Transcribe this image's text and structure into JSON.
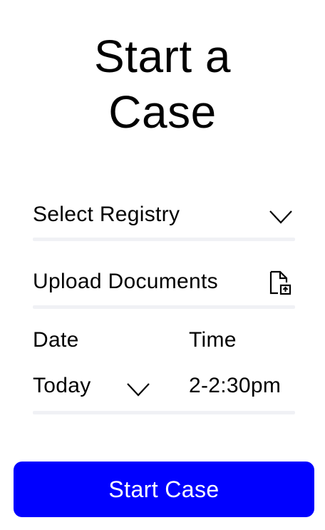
{
  "page": {
    "title_line1": "Start a",
    "title_line2": "Case"
  },
  "form": {
    "registry": {
      "placeholder": "Select Registry",
      "icon": "chevron-down-icon"
    },
    "documents": {
      "label": "Upload Documents",
      "icon": "file-upload-icon"
    },
    "date": {
      "label": "Date",
      "value": "Today",
      "icon": "chevron-down-icon"
    },
    "time": {
      "label": "Time",
      "value": "2-2:30pm"
    }
  },
  "actions": {
    "start_label": "Start Case"
  },
  "colors": {
    "accent": "#0000ff",
    "underline": "#f0f1f5",
    "text": "#000000"
  }
}
